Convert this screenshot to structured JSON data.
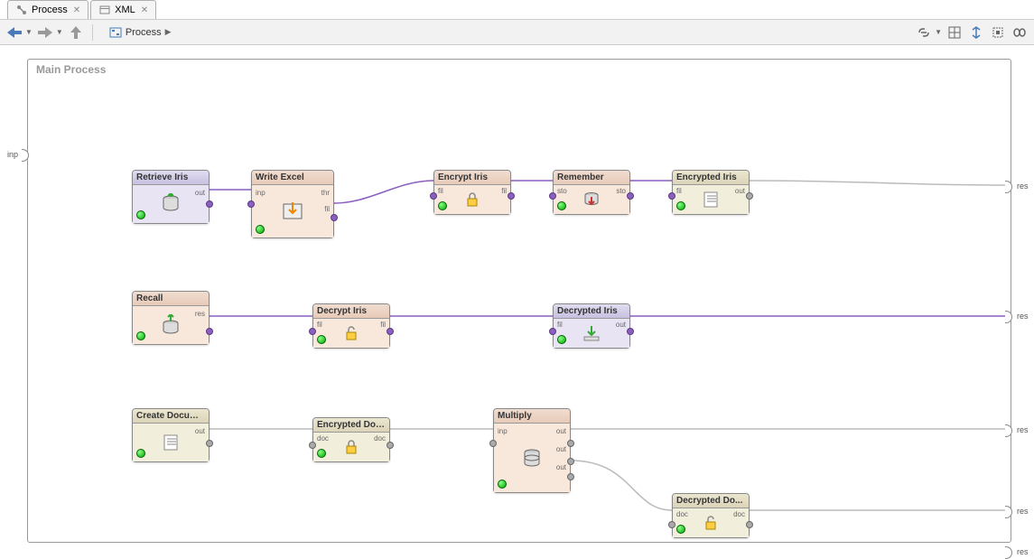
{
  "tabs": [
    {
      "label": "Process",
      "icon": "process"
    },
    {
      "label": "XML",
      "icon": "xml"
    }
  ],
  "breadcrumb": {
    "label": "Process"
  },
  "canvas": {
    "title": "Main Process"
  },
  "global_ports": {
    "inp": "inp",
    "res": "res"
  },
  "nodes": {
    "retrieve_iris": {
      "title": "Retrieve Iris",
      "ports": {
        "out": "out"
      }
    },
    "write_excel": {
      "title": "Write Excel",
      "ports": {
        "inp": "inp",
        "thr": "thr",
        "fil": "fil"
      }
    },
    "encrypt_iris": {
      "title": "Encrypt Iris",
      "ports": {
        "fil_in": "fil",
        "fil_out": "fil"
      }
    },
    "remember": {
      "title": "Remember",
      "ports": {
        "sto_in": "sto",
        "sto_out": "sto"
      }
    },
    "encrypted_iris": {
      "title": "Encrypted Iris",
      "ports": {
        "fil": "fil",
        "out": "out"
      }
    },
    "recall": {
      "title": "Recall",
      "ports": {
        "res": "res"
      }
    },
    "decrypt_iris": {
      "title": "Decrypt Iris",
      "ports": {
        "fil_in": "fil",
        "fil_out": "fil"
      }
    },
    "decrypted_iris": {
      "title": "Decrypted Iris",
      "ports": {
        "fil": "fil",
        "out": "out"
      }
    },
    "create_docum": {
      "title": "Create Docum...",
      "ports": {
        "out": "out"
      }
    },
    "encrypted_doc": {
      "title": "Encrypted Doc...",
      "ports": {
        "doc_in": "doc",
        "doc_out": "doc"
      }
    },
    "multiply": {
      "title": "Multiply",
      "ports": {
        "inp": "inp",
        "out1": "out",
        "out2": "out",
        "out3": "out"
      }
    },
    "decrypted_doc": {
      "title": "Decrypted Do...",
      "ports": {
        "doc_in": "doc",
        "doc_out": "doc"
      }
    }
  }
}
